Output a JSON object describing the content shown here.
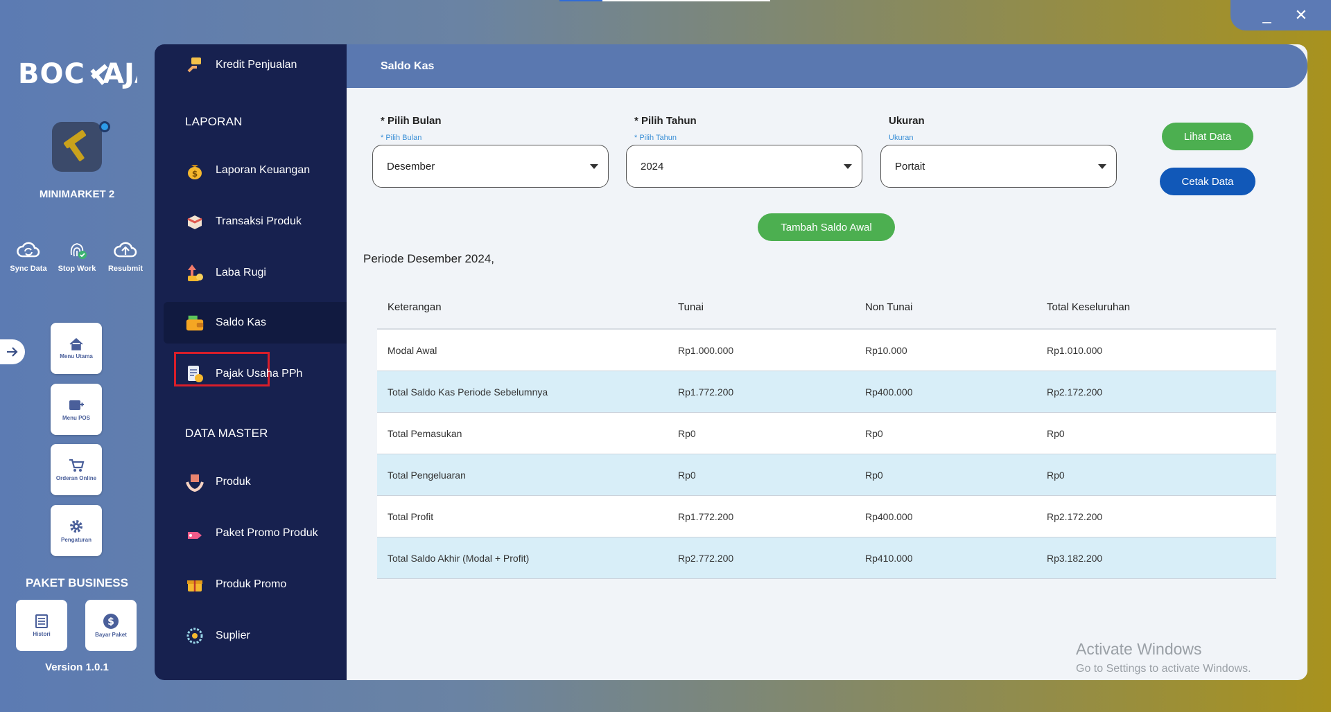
{
  "app": {
    "brand": "BOC AJA",
    "store_name": "MINIMARKET 2",
    "version": "Version 1.0.1",
    "paket_title": "PAKET BUSINESS"
  },
  "window": {
    "minimize": "_",
    "close": "✕"
  },
  "rail_actions": [
    {
      "label": "Sync Data",
      "icon": "cloud-sync-icon"
    },
    {
      "label": "Stop Work",
      "icon": "fingerprint-icon"
    },
    {
      "label": "Resubmit",
      "icon": "cloud-upload-icon"
    }
  ],
  "rail_tiles": [
    {
      "label": "Menu Utama",
      "icon": "home-icon"
    },
    {
      "label": "Menu POS",
      "icon": "pos-icon"
    },
    {
      "label": "Orderan Online",
      "icon": "cart-icon"
    },
    {
      "label": "Pengaturan",
      "icon": "gear-icon"
    }
  ],
  "paket_tiles": [
    {
      "label": "Histori",
      "icon": "history-icon"
    },
    {
      "label": "Bayar Paket",
      "icon": "dollar-icon"
    }
  ],
  "sidebar": {
    "top_item": "Kredit Penjualan",
    "section_laporan": "LAPORAN",
    "laporan_items": [
      {
        "label": "Laporan Keuangan",
        "icon": "money-bag-icon"
      },
      {
        "label": "Transaksi Produk",
        "icon": "box-icon"
      },
      {
        "label": "Laba Rugi",
        "icon": "profit-icon"
      },
      {
        "label": "Saldo Kas",
        "icon": "wallet-icon"
      },
      {
        "label": "Pajak Usaha PPh",
        "icon": "tax-document-icon"
      }
    ],
    "section_master": "DATA MASTER",
    "master_items": [
      {
        "label": "Produk",
        "icon": "product-hands-icon"
      },
      {
        "label": "Paket Promo Produk",
        "icon": "promo-tag-icon"
      },
      {
        "label": "Produk Promo",
        "icon": "gift-box-icon"
      },
      {
        "label": "Suplier",
        "icon": "supplier-icon"
      }
    ]
  },
  "page": {
    "title": "Saldo Kas",
    "bulan": {
      "label": "* Pilih Bulan",
      "hint": "* Pilih Bulan",
      "value": "Desember"
    },
    "tahun": {
      "label": "* Pilih Tahun",
      "hint": "* Pilih Tahun",
      "value": "2024"
    },
    "ukuran": {
      "label": "Ukuran",
      "hint": "Ukuran",
      "value": "Portait"
    },
    "lihat_data": "Lihat Data",
    "cetak_data": "Cetak Data",
    "tambah_saldo": "Tambah Saldo Awal",
    "periode": "Periode Desember 2024,"
  },
  "table": {
    "headers": [
      "Keterangan",
      "Tunai",
      "Non Tunai",
      "Total Keseluruhan"
    ],
    "rows": [
      [
        "Modal Awal",
        "Rp1.000.000",
        "Rp10.000",
        "Rp1.010.000"
      ],
      [
        "Total Saldo Kas Periode Sebelumnya",
        "Rp1.772.200",
        "Rp400.000",
        "Rp2.172.200"
      ],
      [
        "Total Pemasukan",
        "Rp0",
        "Rp0",
        "Rp0"
      ],
      [
        "Total Pengeluaran",
        "Rp0",
        "Rp0",
        "Rp0"
      ],
      [
        "Total Profit",
        "Rp1.772.200",
        "Rp400.000",
        "Rp2.172.200"
      ],
      [
        "Total Saldo Akhir (Modal + Profit)",
        "Rp2.772.200",
        "Rp410.000",
        "Rp3.182.200"
      ]
    ]
  },
  "watermark": {
    "line1": "Activate Windows",
    "line2": "Go to Settings to activate Windows."
  },
  "colors": {
    "sidebar": "#17214f",
    "header": "#5a78b0",
    "green": "#4caf50",
    "blue": "#1158b8",
    "row_alt": "#d8eef8",
    "active_outline": "#d91e2a"
  }
}
